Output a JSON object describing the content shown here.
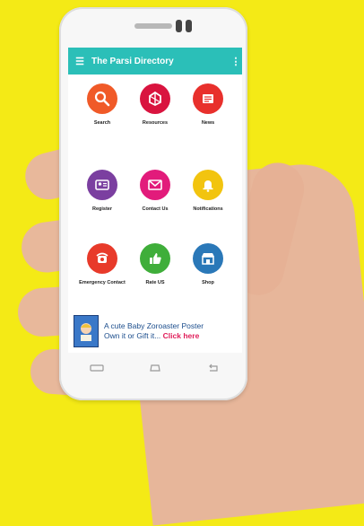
{
  "app": {
    "title": "The Parsi Directory",
    "menu_icon": "hamburger-menu-icon",
    "overflow_icon": "more-vertical-icon",
    "appbar_color": "#2bbfb8"
  },
  "tiles": [
    {
      "label": "Search",
      "icon": "search-icon",
      "color": "#f05a28"
    },
    {
      "label": "Resources",
      "icon": "resources-icon",
      "color": "#d9143f"
    },
    {
      "label": "News",
      "icon": "news-icon",
      "color": "#e8302c"
    },
    {
      "label": "Register",
      "icon": "register-icon",
      "color": "#7b3fa0"
    },
    {
      "label": "Contact Us",
      "icon": "mail-icon",
      "color": "#e21b7b"
    },
    {
      "label": "Notifications",
      "icon": "bell-icon",
      "color": "#f2c40f"
    },
    {
      "label": "Emergency Contact",
      "icon": "phone-alarm-icon",
      "color": "#e83a2a"
    },
    {
      "label": "Rate US",
      "icon": "thumbs-up-icon",
      "color": "#3fae3a"
    },
    {
      "label": "Shop",
      "icon": "shop-icon",
      "color": "#2a78b8"
    }
  ],
  "banner": {
    "line1": "A cute Baby Zoroaster Poster",
    "line2": "Own it or Gift it...",
    "link": "Click here"
  }
}
